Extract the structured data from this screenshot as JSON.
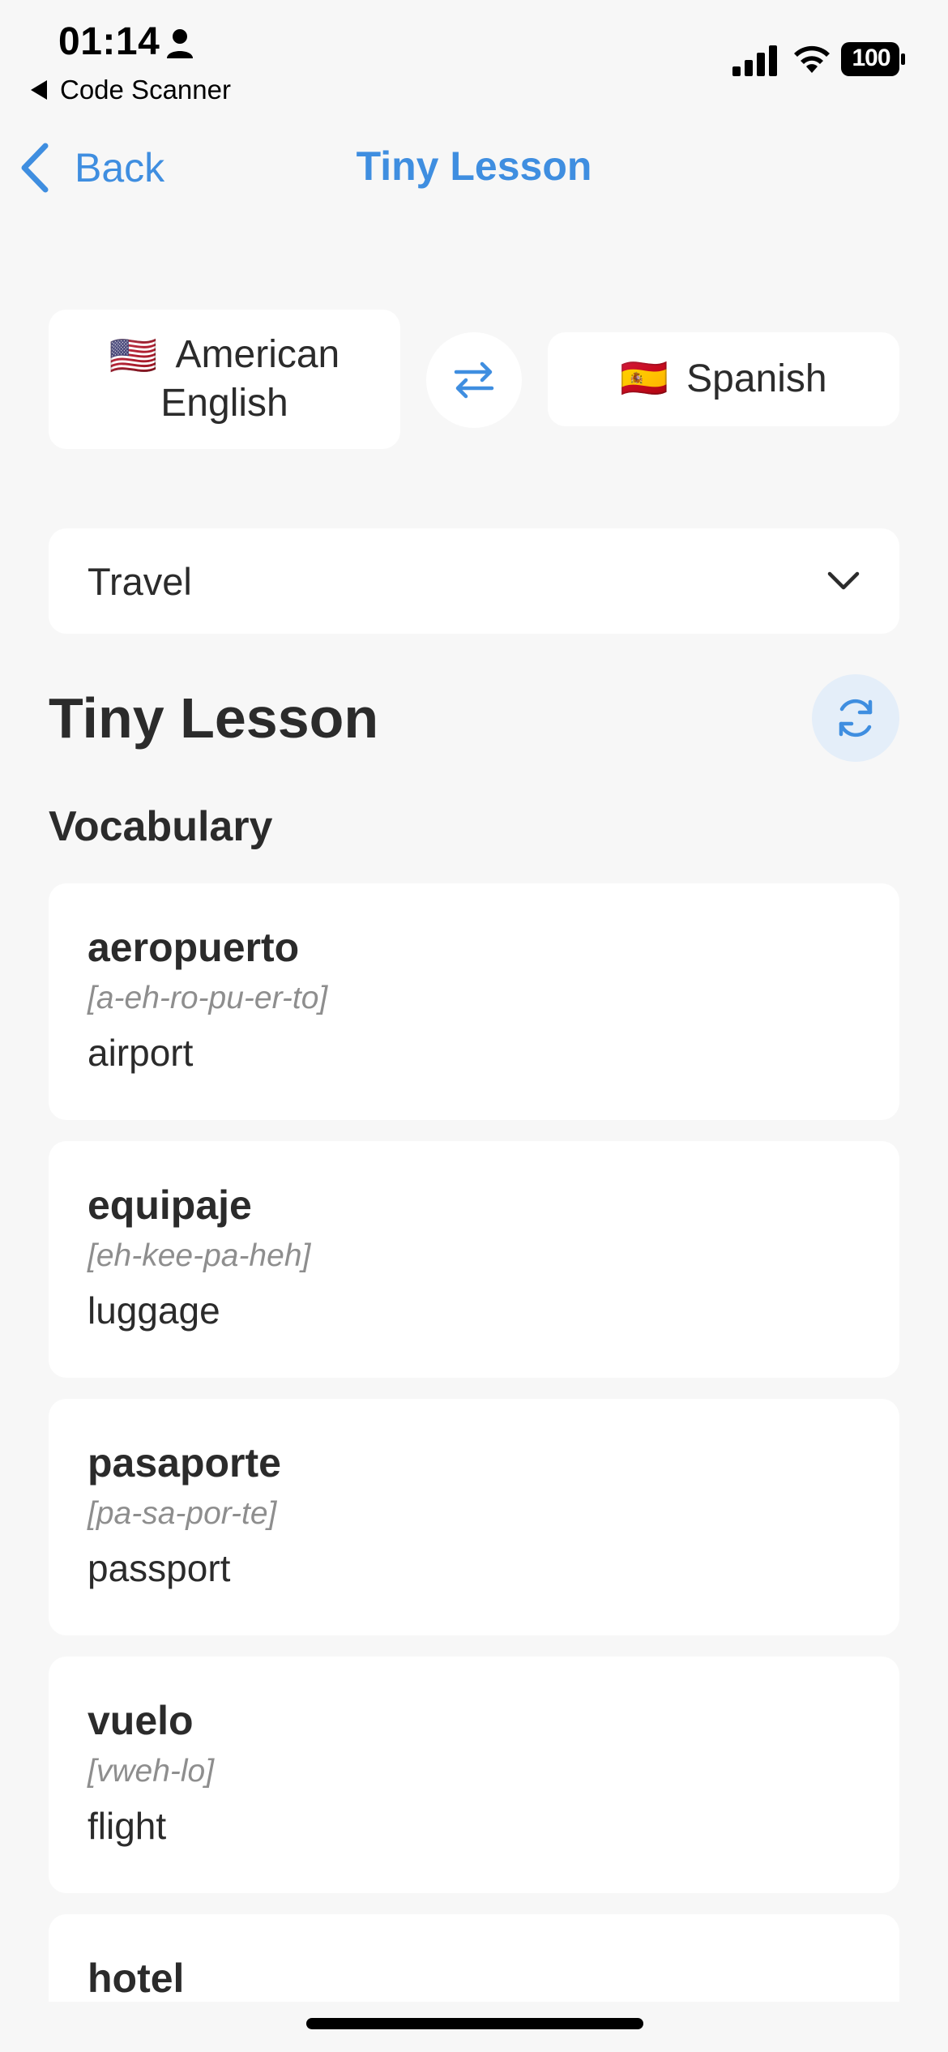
{
  "status_bar": {
    "time": "01:14",
    "back_app_label": "Code Scanner",
    "battery": "100"
  },
  "nav": {
    "back_label": "Back",
    "title": "Tiny Lesson"
  },
  "languages": {
    "from": {
      "flag": "🇺🇸",
      "line1": "American",
      "line2": "English"
    },
    "to": {
      "flag": "🇪🇸",
      "label": "Spanish"
    }
  },
  "category": {
    "selected": "Travel"
  },
  "lesson": {
    "heading": "Tiny Lesson",
    "section_title": "Vocabulary",
    "vocabulary": [
      {
        "word": "aeropuerto",
        "pronunciation": "[a-eh-ro-pu-er-to]",
        "meaning": "airport"
      },
      {
        "word": "equipaje",
        "pronunciation": "[eh-kee-pa-heh]",
        "meaning": "luggage"
      },
      {
        "word": "pasaporte",
        "pronunciation": "[pa-sa-por-te]",
        "meaning": "passport"
      },
      {
        "word": "vuelo",
        "pronunciation": "[vweh-lo]",
        "meaning": "flight"
      },
      {
        "word": "hotel",
        "pronunciation": "",
        "meaning": ""
      }
    ]
  },
  "colors": {
    "accent": "#3f8ee0",
    "background": "#f7f7f7",
    "card": "#ffffff",
    "muted_text": "#8e8e8e",
    "refresh_bg": "#e4eef9"
  },
  "icons": {
    "back": "chevron-left-icon",
    "swap": "swap-arrows-icon",
    "dropdown": "chevron-down-icon",
    "refresh": "refresh-icon"
  }
}
